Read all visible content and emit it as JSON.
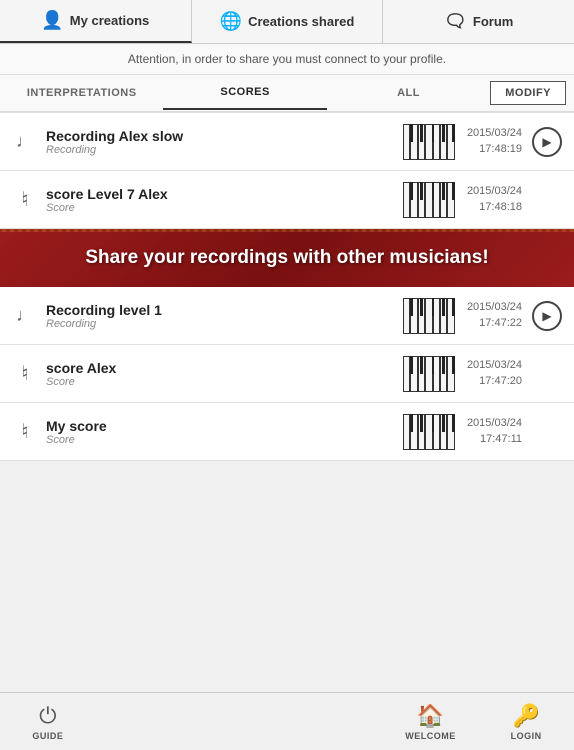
{
  "nav": {
    "tabs": [
      {
        "id": "my-creations",
        "label": "My creations",
        "icon": "👤",
        "active": true
      },
      {
        "id": "creations-shared",
        "label": "Creations shared",
        "icon": "🌐",
        "active": false
      },
      {
        "id": "forum",
        "label": "Forum",
        "icon": "🗨",
        "active": false
      }
    ]
  },
  "attention": {
    "text": "Attention, in order to share you must connect to your profile."
  },
  "filters": {
    "tabs": [
      {
        "id": "interpretations",
        "label": "INTERPRETATIONS",
        "active": false
      },
      {
        "id": "scores",
        "label": "SCORES",
        "active": false
      },
      {
        "id": "all",
        "label": "ALL",
        "active": false
      }
    ],
    "modify_label": "MODIFY"
  },
  "items": [
    {
      "id": "item1",
      "title": "Recording Alex slow",
      "subtitle": "Recording",
      "type": "recording",
      "date": "2015/03/24",
      "time": "17:48:19",
      "has_play": true
    },
    {
      "id": "item2",
      "title": "score Level 7 Alex",
      "subtitle": "Score",
      "type": "score",
      "date": "2015/03/24",
      "time": "17:48:18",
      "has_play": false
    }
  ],
  "promo": {
    "text": "Share your recordings with other musicians!"
  },
  "items2": [
    {
      "id": "item3",
      "title": "Recording level 1",
      "subtitle": "Recording",
      "type": "recording",
      "date": "2015/03/24",
      "time": "17:47:22",
      "has_play": true
    },
    {
      "id": "item4",
      "title": "score Alex",
      "subtitle": "Score",
      "type": "score",
      "date": "2015/03/24",
      "time": "17:47:20",
      "has_play": false
    },
    {
      "id": "item5",
      "title": "My score",
      "subtitle": "Score",
      "type": "score",
      "date": "2015/03/24",
      "time": "17:47:11",
      "has_play": false
    }
  ],
  "bottom_nav": {
    "tabs": [
      {
        "id": "guide",
        "label": "GUIDE",
        "icon": "⏻"
      },
      {
        "id": "welcome",
        "label": "WELCOME",
        "icon": "🏠"
      },
      {
        "id": "login",
        "label": "LOGIN",
        "icon": "🔑"
      }
    ]
  },
  "colors": {
    "accent_red": "#8b1a1a",
    "nav_border": "#cccccc"
  }
}
